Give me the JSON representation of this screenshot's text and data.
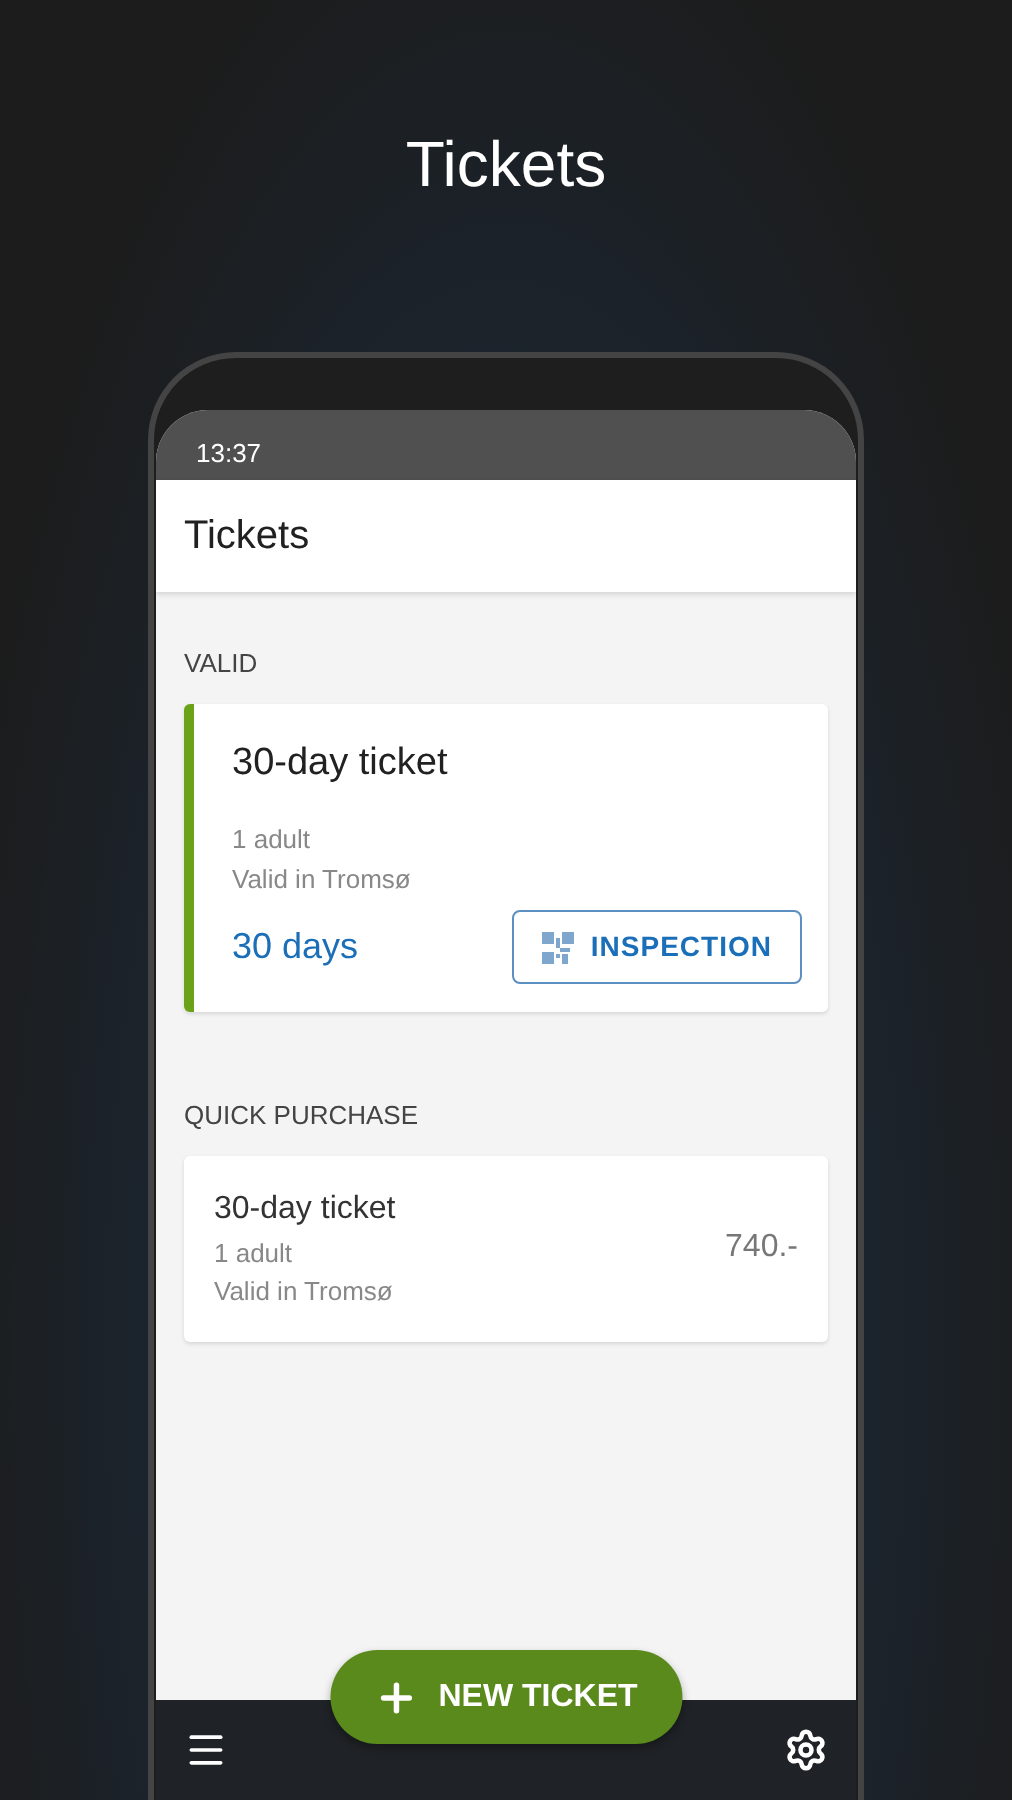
{
  "headline": "Tickets",
  "status_bar": {
    "time": "13:37"
  },
  "app_bar": {
    "title": "Tickets"
  },
  "valid": {
    "heading": "VALID",
    "ticket": {
      "name": "30-day ticket",
      "passengers": "1 adult",
      "zone": "Valid in Tromsø",
      "remaining": "30 days",
      "button": "INSPECTION",
      "color": "#6aa318"
    }
  },
  "quick_purchase": {
    "heading": "QUICK PURCHASE",
    "item": {
      "name": "30-day ticket",
      "passengers": "1 adult",
      "zone": "Valid in Tromsø",
      "price": "740.-"
    }
  },
  "fab": {
    "label": "NEW TICKET"
  }
}
